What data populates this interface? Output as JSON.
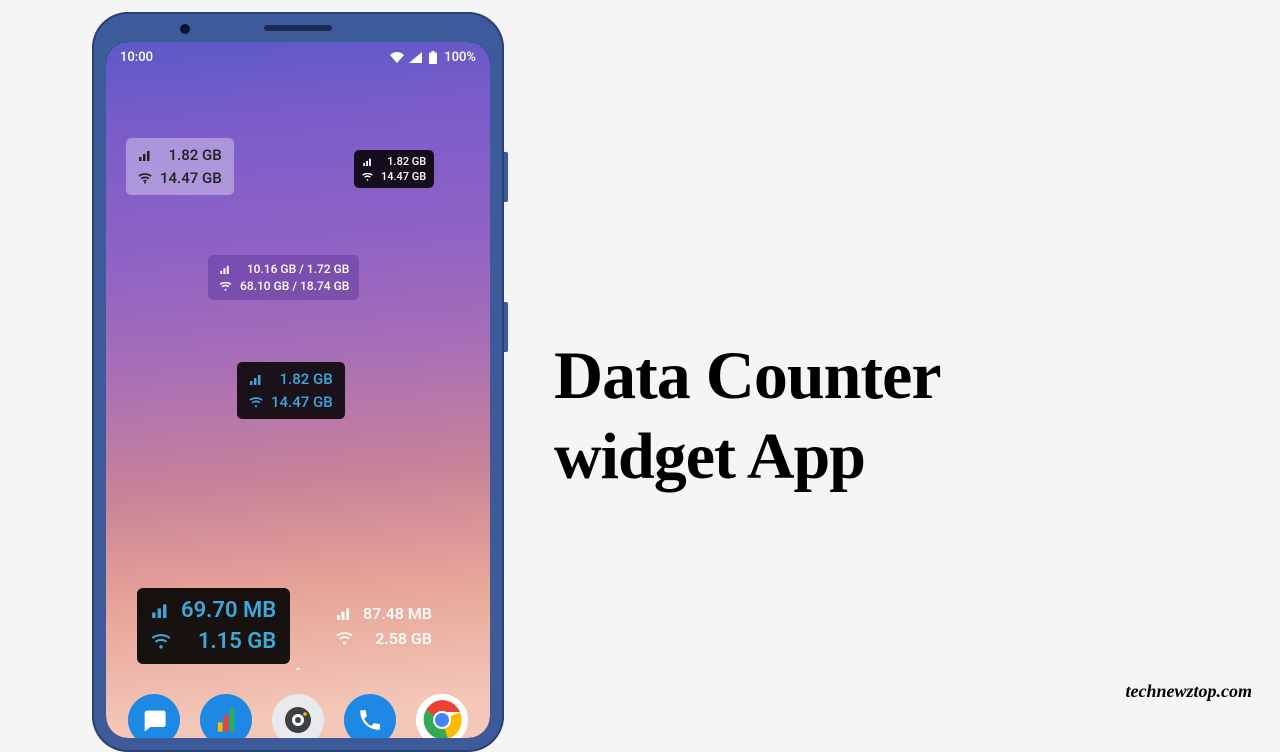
{
  "status": {
    "time": "10:00",
    "battery": "100%"
  },
  "widgets": {
    "light": {
      "cell": "1.82 GB",
      "wifi": "14.47 GB"
    },
    "darkSmall": {
      "cell": "1.82 GB",
      "wifi": "14.47 GB"
    },
    "purple": {
      "cell": "10.16 GB / 1.72 GB",
      "wifi": "68.10 GB / 18.74 GB"
    },
    "darkBlue": {
      "cell": "1.82 GB",
      "wifi": "14.47 GB"
    },
    "bigBlue": {
      "cell": "69.70 MB",
      "wifi": "1.15 GB"
    },
    "transWhite": {
      "cell": "87.48 MB",
      "wifi": "2.58 GB"
    }
  },
  "heading": {
    "line1": "Data Counter",
    "line2": "widget App"
  },
  "watermark": "technewztop.com",
  "dock": {
    "colors": {
      "messages": "#1e88e5",
      "files": "#1e88e5",
      "camera": "#e8eaed",
      "phone": "#1e88e5",
      "chrome": "#fff"
    }
  }
}
